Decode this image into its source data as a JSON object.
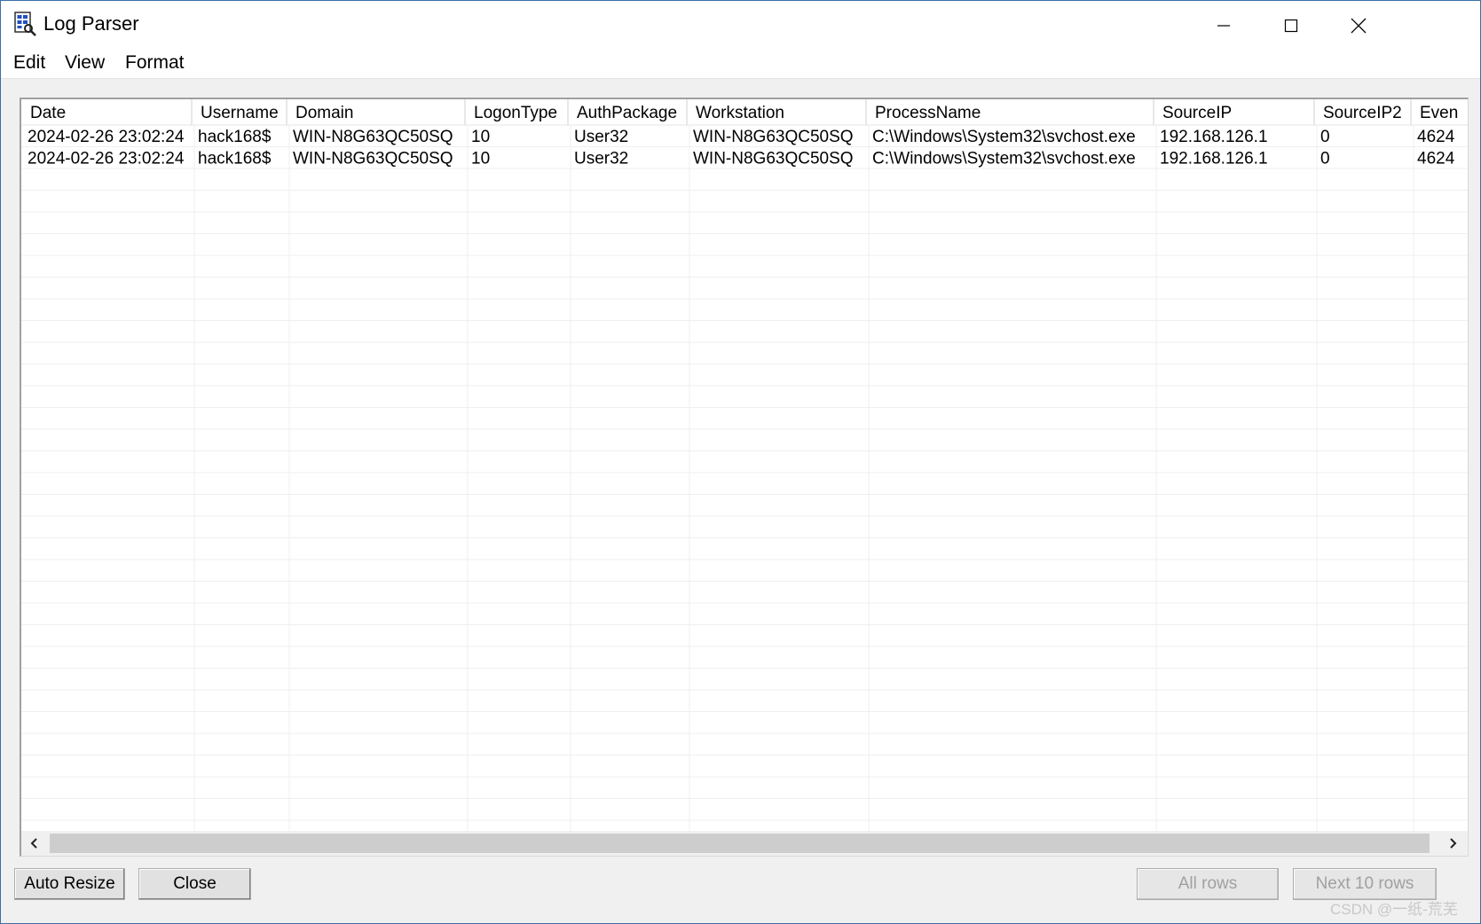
{
  "window": {
    "title": "Log Parser",
    "icon": "log-parser-app-icon"
  },
  "titlebar_buttons": [
    "minimize-icon",
    "maximize-icon",
    "close-icon"
  ],
  "menu": [
    "Edit",
    "View",
    "Format"
  ],
  "table": {
    "columns": [
      "Date",
      "Username",
      "Domain",
      "LogonType",
      "AuthPackage",
      "Workstation",
      "ProcessName",
      "SourceIP",
      "SourceIP2",
      "Even"
    ],
    "rows": [
      [
        "2024-02-26 23:02:24",
        "hack168$",
        "WIN-N8G63QC50SQ",
        "10",
        "User32",
        "WIN-N8G63QC50SQ",
        "C:\\Windows\\System32\\svchost.exe",
        "192.168.126.1",
        "0",
        "4624"
      ],
      [
        "2024-02-26 23:02:24",
        "hack168$",
        "WIN-N8G63QC50SQ",
        "10",
        "User32",
        "WIN-N8G63QC50SQ",
        "C:\\Windows\\System32\\svchost.exe",
        "192.168.126.1",
        "0",
        "4624"
      ]
    ]
  },
  "buttons": {
    "auto_resize": "Auto Resize",
    "close": "Close",
    "all_rows": "All rows",
    "next_10_rows": "Next 10 rows"
  },
  "watermark": "CSDN @一纸-荒芜",
  "colors": {
    "window_border": "#3a6ea5",
    "client_bg": "#f0f0f0",
    "grid_line": "#e8e8e8",
    "disabled_text": "#a0a0a0"
  }
}
